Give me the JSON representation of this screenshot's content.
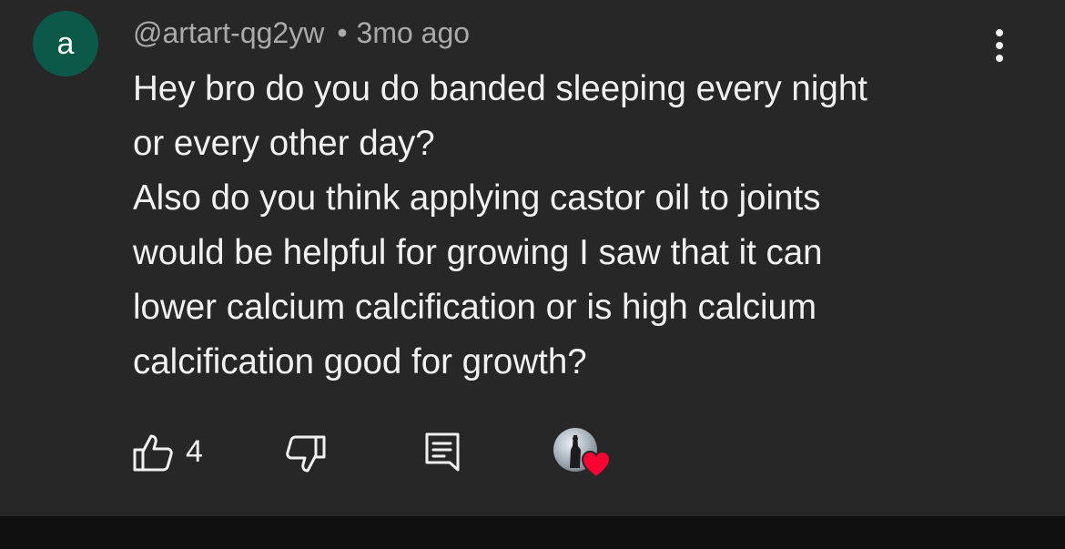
{
  "comment": {
    "author_initial": "a",
    "author_handle": "@artart-qg2yw",
    "separator": "•",
    "timestamp": "3mo ago",
    "text_lines": [
      "Hey bro do you do banded sleeping every night",
      "or every other day?",
      "Also do you think applying castor oil to joints",
      "would be helpful for growing I saw that it can",
      "lower calcium calcification or is high calcium",
      "calcification good for growth?"
    ],
    "like_count": "4",
    "avatar_color": "#0b5a49",
    "heart_color": "#ff0033"
  },
  "icons": {
    "more": "more-vertical-icon",
    "like": "thumbs-up-icon",
    "dislike": "thumbs-down-icon",
    "reply": "reply-comment-icon",
    "creator_heart": "creator-heart-icon"
  }
}
